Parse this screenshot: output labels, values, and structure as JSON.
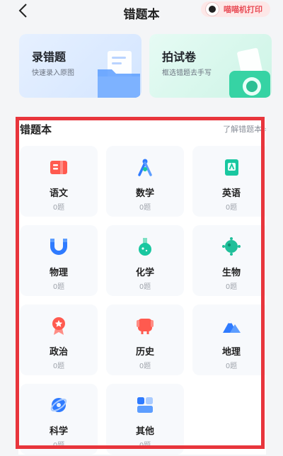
{
  "header": {
    "title": "错题本",
    "brand_label": "喵喵机打印"
  },
  "cards": [
    {
      "title": "录错题",
      "subtitle": "快速录入原图"
    },
    {
      "title": "拍试卷",
      "subtitle": "框选错题去手写"
    }
  ],
  "section": {
    "title": "错题本",
    "link": "了解错题本",
    "subjects": [
      {
        "name": "语文",
        "count": "0题",
        "icon": "chinese-book-icon",
        "color": "#ff5a4f"
      },
      {
        "name": "数学",
        "count": "0题",
        "icon": "compass-icon",
        "color": "#2f7bff"
      },
      {
        "name": "英语",
        "count": "0题",
        "icon": "english-book-icon",
        "color": "#19c7a0"
      },
      {
        "name": "物理",
        "count": "0题",
        "icon": "magnet-icon",
        "color": "#2f7bff"
      },
      {
        "name": "化学",
        "count": "0题",
        "icon": "flask-icon",
        "color": "#19c7a0"
      },
      {
        "name": "生物",
        "count": "0题",
        "icon": "cell-icon",
        "color": "#1fbf9a"
      },
      {
        "name": "政治",
        "count": "0题",
        "icon": "medal-icon",
        "color": "#ff5a4f"
      },
      {
        "name": "历史",
        "count": "0题",
        "icon": "scroll-icon",
        "color": "#ff5a4f"
      },
      {
        "name": "地理",
        "count": "0题",
        "icon": "mountain-icon",
        "color": "#2f7bff"
      },
      {
        "name": "科学",
        "count": "0题",
        "icon": "atom-icon",
        "color": "#2f7bff"
      },
      {
        "name": "其他",
        "count": "0题",
        "icon": "grid-icon",
        "color": "#2f7bff"
      }
    ]
  },
  "colors": {
    "highlight": "#e8353c",
    "blue": "#2f7bff",
    "green": "#19c7a0",
    "red": "#ff5a4f"
  }
}
